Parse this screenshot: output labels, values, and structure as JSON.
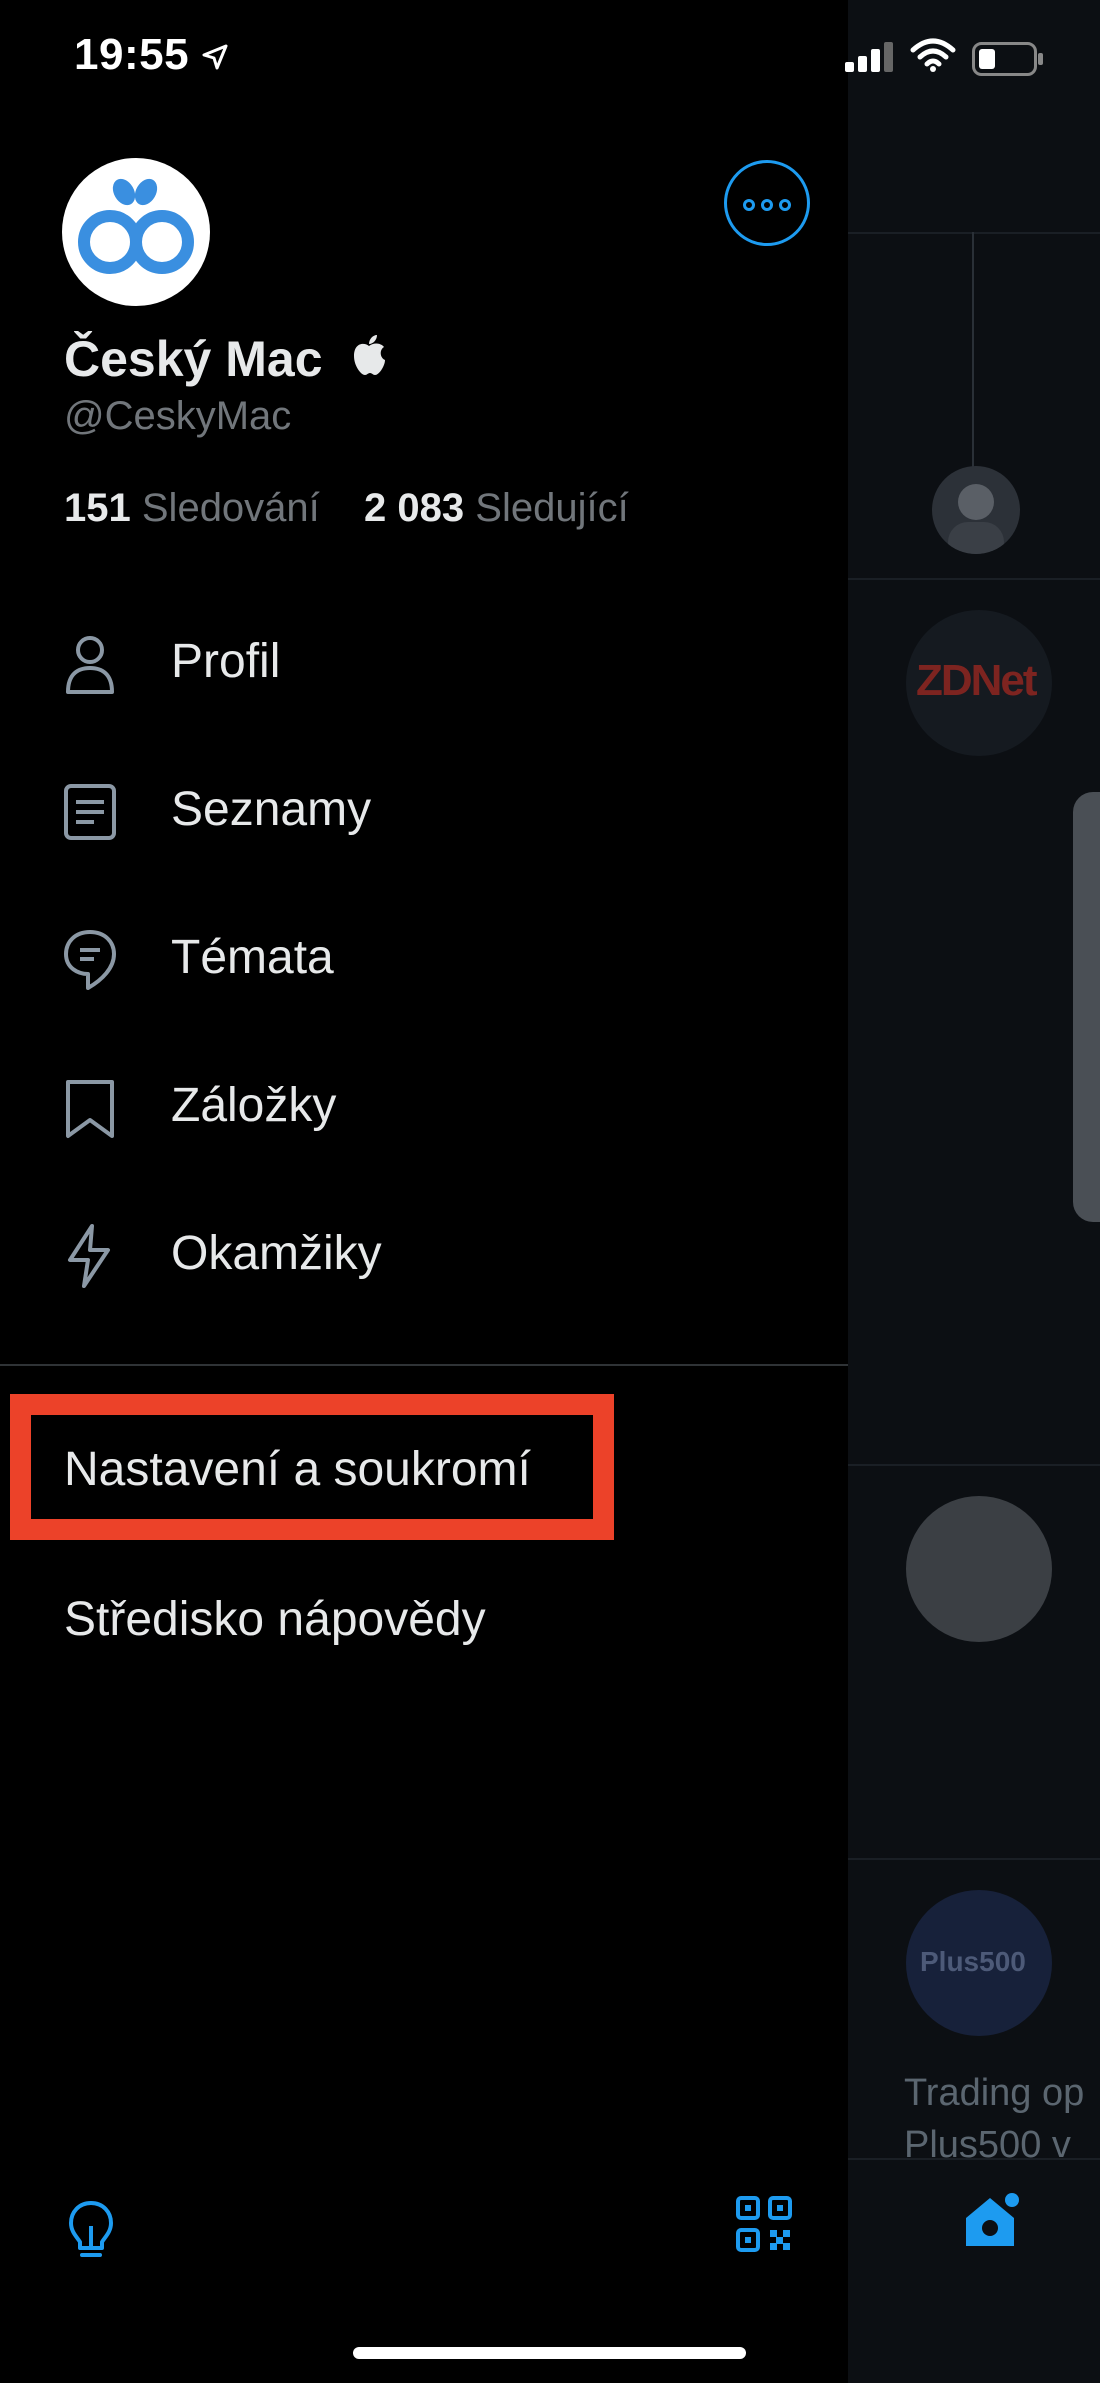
{
  "status_bar": {
    "time": "19:55"
  },
  "profile": {
    "display_name": "Český Mac",
    "handle": "@CeskyMac",
    "following_count": "151",
    "following_label": "Sledování",
    "followers_count": "2 083",
    "followers_label": "Sledující"
  },
  "menu": {
    "items": [
      {
        "label": "Profil",
        "icon": "person-icon"
      },
      {
        "label": "Seznamy",
        "icon": "list-icon"
      },
      {
        "label": "Témata",
        "icon": "topics-icon"
      },
      {
        "label": "Záložky",
        "icon": "bookmark-icon"
      },
      {
        "label": "Okamžiky",
        "icon": "lightning-icon"
      }
    ],
    "settings_label": "Nastavení a soukromí",
    "help_label": "Středisko nápovědy"
  },
  "background_timeline": {
    "avatar_1_text": "ZDNet",
    "avatar_2_text": "Plus500",
    "promo_line_1": "Trading op",
    "promo_line_2": "Plus500 v"
  },
  "colors": {
    "accent": "#1d9bf0",
    "highlight": "#ec4229",
    "background": "#000000"
  }
}
